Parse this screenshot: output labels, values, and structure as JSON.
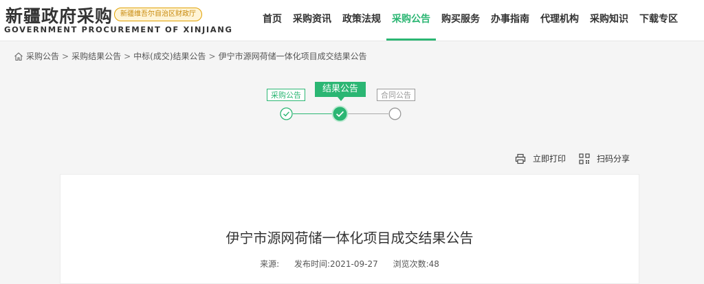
{
  "header": {
    "site_title": "新疆政府采购",
    "badge": "新疆维吾尔自治区财政厅",
    "subtitle": "GOVERNMENT PROCUREMENT OF XINJIANG",
    "nav": [
      {
        "label": "首页"
      },
      {
        "label": "采购资讯"
      },
      {
        "label": "政策法规"
      },
      {
        "label": "采购公告"
      },
      {
        "label": "购买服务"
      },
      {
        "label": "办事指南"
      },
      {
        "label": "代理机构"
      },
      {
        "label": "采购知识"
      },
      {
        "label": "下载专区"
      }
    ],
    "active_nav": "采购公告"
  },
  "breadcrumb": {
    "items": [
      "采购公告",
      "采购结果公告",
      "中标(成交)结果公告",
      "伊宁市源网荷储一体化项目成交结果公告"
    ],
    "separator": ">"
  },
  "steps": {
    "items": [
      {
        "label": "采购公告",
        "state": "done"
      },
      {
        "label": "结果公告",
        "state": "current"
      },
      {
        "label": "合同公告",
        "state": "pending"
      }
    ]
  },
  "tools": {
    "print": "立即打印",
    "share": "扫码分享"
  },
  "article": {
    "title": "伊宁市源网荷储一体化项目成交结果公告",
    "source_label": "来源:",
    "source_value": "",
    "date_label": "发布时间:",
    "date_value": "2021-09-27",
    "views_label": "浏览次数:",
    "views_value": "48"
  },
  "colors": {
    "accent": "#2bb673",
    "badge_bg": "#fff4d6",
    "badge_text": "#c7880a"
  }
}
